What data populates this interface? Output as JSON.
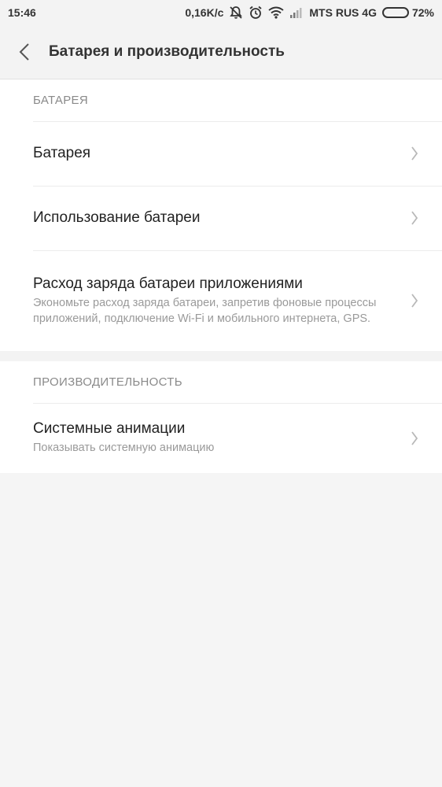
{
  "status": {
    "time": "15:46",
    "speed": "0,16K/c",
    "carrier": "MTS RUS 4G",
    "battery_percent": "72%",
    "battery_level": 0.72
  },
  "header": {
    "title": "Батарея и производительность"
  },
  "sections": [
    {
      "header": "БАТАРЕЯ",
      "items": [
        {
          "title": "Батарея"
        },
        {
          "title": "Использование батареи"
        },
        {
          "title": "Расход заряда батареи приложениями",
          "subtitle": "Экономьте расход заряда батареи, запретив фоновые процессы приложений, подключение Wi-Fi и мобильного интернета, GPS."
        }
      ]
    },
    {
      "header": "ПРОИЗВОДИТЕЛЬНОСТЬ",
      "items": [
        {
          "title": "Системные анимации",
          "subtitle": "Показывать системную анимацию"
        }
      ]
    }
  ]
}
